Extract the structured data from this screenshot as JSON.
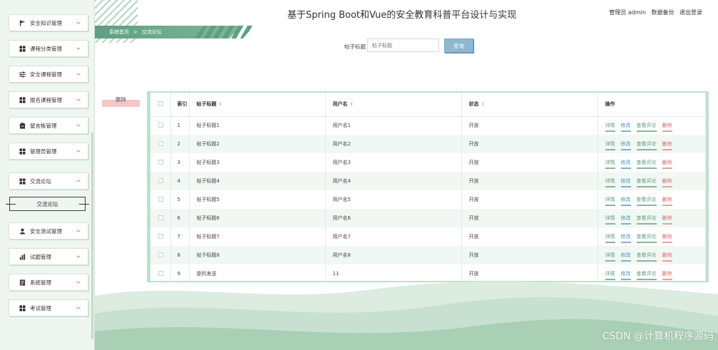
{
  "app": {
    "title": "基于Spring Boot和Vue的安全教育科普平台设计与实现",
    "user": {
      "role_name": "管理员 admin",
      "backup": "数据备份",
      "logout": "退出登录"
    }
  },
  "breadcrumb": {
    "home": "系统首页",
    "sep": ">",
    "current": "交流论坛"
  },
  "sidebar": {
    "items": [
      {
        "label": "安全知识管理",
        "icon": "flag-icon",
        "arrow": "chevron-down-icon"
      },
      {
        "label": "课程分类管理",
        "icon": "grid-icon",
        "arrow": "chevron-down-icon"
      },
      {
        "label": "安全课程管理",
        "icon": "sliders-icon",
        "arrow": "chevron-down-icon"
      },
      {
        "label": "报名课程管理",
        "icon": "grid-icon",
        "arrow": "chevron-down-icon"
      },
      {
        "label": "留言板管理",
        "icon": "clipboard-icon",
        "arrow": "chevron-down-icon"
      },
      {
        "label": "管理员管理",
        "icon": "grid-icon",
        "arrow": "chevron-down-icon"
      },
      {
        "label": "交流论坛",
        "icon": "grid-icon",
        "arrow": "chevron-up-icon"
      },
      {
        "label": "安全测试管理",
        "icon": "user-icon",
        "arrow": "chevron-down-icon"
      },
      {
        "label": "试题管理",
        "icon": "bar-chart-icon",
        "arrow": "chevron-down-icon"
      },
      {
        "label": "系统管理",
        "icon": "document-icon",
        "arrow": "chevron-down-icon"
      },
      {
        "label": "考试管理",
        "icon": "grid-icon",
        "arrow": "chevron-down-icon"
      }
    ],
    "submenu": {
      "label": "交流论坛"
    }
  },
  "search": {
    "label": "帖子标题",
    "placeholder": "帖子标题",
    "button": "查询"
  },
  "actions": {
    "delete": "删除"
  },
  "table": {
    "headers": {
      "index": "索引",
      "title": "帖子标题",
      "username": "用户名",
      "status": "状态",
      "ops": "操作"
    },
    "op_labels": {
      "detail": "详情",
      "edit": "修改",
      "view_comments": "查看评论",
      "delete": "删除"
    },
    "rows": [
      {
        "index": "1",
        "title": "帖子标题1",
        "username": "用户名1",
        "status": "开放"
      },
      {
        "index": "2",
        "title": "帖子标题2",
        "username": "用户名2",
        "status": "开放"
      },
      {
        "index": "3",
        "title": "帖子标题3",
        "username": "用户名3",
        "status": "开放"
      },
      {
        "index": "4",
        "title": "帖子标题4",
        "username": "用户名4",
        "status": "开放"
      },
      {
        "index": "5",
        "title": "帖子标题5",
        "username": "用户名5",
        "status": "开放"
      },
      {
        "index": "6",
        "title": "帖子标题6",
        "username": "用户名6",
        "status": "开放"
      },
      {
        "index": "7",
        "title": "帖子标题7",
        "username": "用户名7",
        "status": "开放"
      },
      {
        "index": "8",
        "title": "帖子标题8",
        "username": "用户名8",
        "status": "开放"
      },
      {
        "index": "9",
        "title": "是的发送",
        "username": "11",
        "status": "开放"
      }
    ]
  },
  "watermark": "CSDN @计算机程序源码",
  "colors": {
    "sidebar_bg": "#eef6ef",
    "accent_green": "#5f9e83",
    "query_button": "#8db8cf",
    "delete_red": "#d46a6a"
  }
}
